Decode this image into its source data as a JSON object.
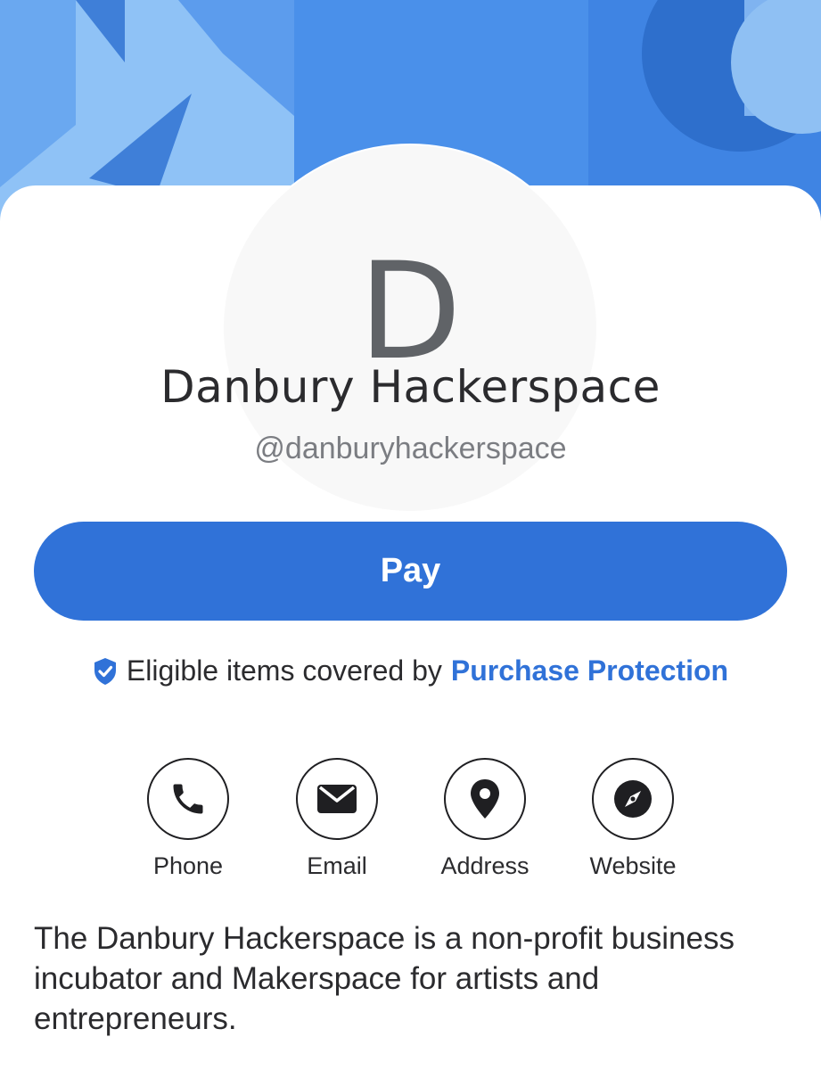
{
  "profile": {
    "initial": "D",
    "name": "Danbury Hackerspace",
    "handle": "@danburyhackerspace"
  },
  "actions": {
    "pay_label": "Pay"
  },
  "protection": {
    "text": "Eligible items covered by",
    "link": "Purchase Protection"
  },
  "contacts": [
    {
      "label": "Phone",
      "icon": "phone-icon"
    },
    {
      "label": "Email",
      "icon": "envelope-icon"
    },
    {
      "label": "Address",
      "icon": "map-pin-icon"
    },
    {
      "label": "Website",
      "icon": "compass-icon"
    }
  ],
  "bio": "The Danbury Hackerspace is a non-profit business incubator and Makerspace for artists and entrepreneurs.",
  "colors": {
    "accent": "#3072d8",
    "banner": "#4a8fe8",
    "text": "#2b2b2e",
    "muted": "#7b7d82"
  }
}
